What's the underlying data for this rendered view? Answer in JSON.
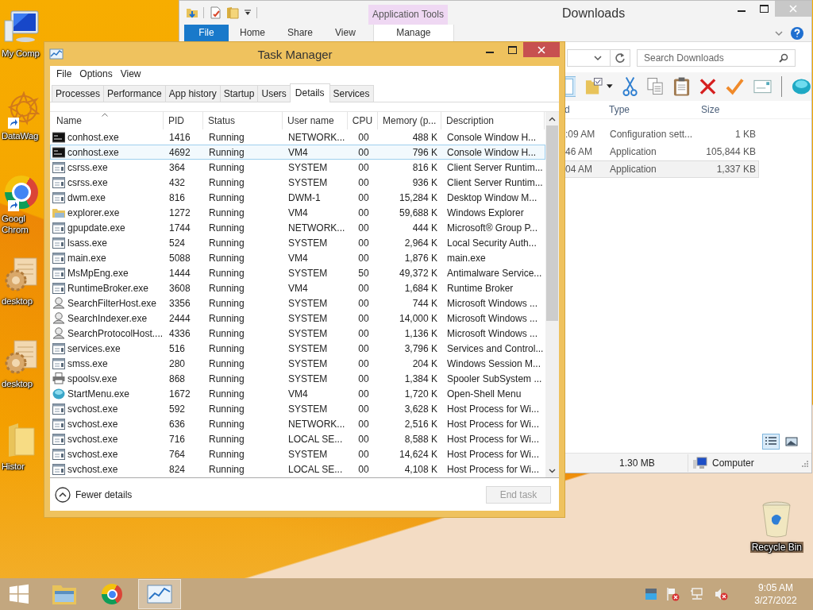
{
  "desktop_icons": [
    {
      "kind": "computer",
      "lines": [
        "My Comp"
      ],
      "shortcut": false
    },
    {
      "kind": "flower",
      "lines": [
        "DataWag"
      ],
      "shortcut": true
    },
    {
      "kind": "chrome",
      "lines": [
        "Googl",
        "Chrom"
      ],
      "shortcut": true
    },
    {
      "kind": "gear-doc",
      "lines": [
        "desktop"
      ],
      "shortcut": false
    },
    {
      "kind": "gear-doc",
      "lines": [
        "desktop"
      ],
      "shortcut": false
    },
    {
      "kind": "folder",
      "lines": [
        "Histor"
      ],
      "shortcut": false
    }
  ],
  "recycle_bin": {
    "label": "Recycle Bin"
  },
  "explorer": {
    "title": "Downloads",
    "context_tab": "Application Tools",
    "ribbon_tabs": [
      {
        "label": "File",
        "selected": true
      },
      {
        "label": "Home",
        "selected": false
      },
      {
        "label": "Share",
        "selected": false
      },
      {
        "label": "View",
        "selected": false
      },
      {
        "label": "Manage",
        "selected": false
      }
    ],
    "search": {
      "placeholder": "Search Downloads"
    },
    "columns": [
      "d",
      "Type",
      "Size"
    ],
    "rows": [
      {
        "date": ":09 AM",
        "type": "Configuration sett...",
        "size": "1 KB",
        "selected": false
      },
      {
        "date": "46 AM",
        "type": "Application",
        "size": "105,844 KB",
        "selected": false
      },
      {
        "date": "04 AM",
        "type": "Application",
        "size": "1,337 KB",
        "selected": true
      }
    ],
    "status_bar": {
      "size": "1.30 MB",
      "location": "Computer"
    }
  },
  "task_manager": {
    "title": "Task Manager",
    "menu": [
      "File",
      "Options",
      "View"
    ],
    "tabs": [
      {
        "label": "Processes",
        "selected": false
      },
      {
        "label": "Performance",
        "selected": false
      },
      {
        "label": "App history",
        "selected": false
      },
      {
        "label": "Startup",
        "selected": false
      },
      {
        "label": "Users",
        "selected": false
      },
      {
        "label": "Details",
        "selected": true
      },
      {
        "label": "Services",
        "selected": false
      }
    ],
    "columns": [
      {
        "label": "Name",
        "sorted": true
      },
      {
        "label": "PID",
        "sorted": false
      },
      {
        "label": "Status",
        "sorted": false
      },
      {
        "label": "User name",
        "sorted": false
      },
      {
        "label": "CPU",
        "sorted": false
      },
      {
        "label": "Memory (p...",
        "sorted": false
      },
      {
        "label": "Description",
        "sorted": false
      }
    ],
    "rows": [
      {
        "kind": "console",
        "name": "conhost.exe",
        "pid": "1416",
        "status": "Running",
        "user": "NETWORK...",
        "cpu": "00",
        "memory": "488 K",
        "description": "Console Window H...",
        "selected": false
      },
      {
        "kind": "console",
        "name": "conhost.exe",
        "pid": "4692",
        "status": "Running",
        "user": "VM4",
        "cpu": "00",
        "memory": "796 K",
        "description": "Console Window H...",
        "selected": true
      },
      {
        "kind": "app",
        "name": "csrss.exe",
        "pid": "364",
        "status": "Running",
        "user": "SYSTEM",
        "cpu": "00",
        "memory": "816 K",
        "description": "Client Server Runtim...",
        "selected": false
      },
      {
        "kind": "app",
        "name": "csrss.exe",
        "pid": "432",
        "status": "Running",
        "user": "SYSTEM",
        "cpu": "00",
        "memory": "936 K",
        "description": "Client Server Runtim...",
        "selected": false
      },
      {
        "kind": "app",
        "name": "dwm.exe",
        "pid": "816",
        "status": "Running",
        "user": "DWM-1",
        "cpu": "00",
        "memory": "15,284 K",
        "description": "Desktop Window M...",
        "selected": false
      },
      {
        "kind": "folder",
        "name": "explorer.exe",
        "pid": "1272",
        "status": "Running",
        "user": "VM4",
        "cpu": "00",
        "memory": "59,688 K",
        "description": "Windows Explorer",
        "selected": false
      },
      {
        "kind": "app",
        "name": "gpupdate.exe",
        "pid": "1744",
        "status": "Running",
        "user": "NETWORK...",
        "cpu": "00",
        "memory": "444 K",
        "description": "Microsoft® Group P...",
        "selected": false
      },
      {
        "kind": "app",
        "name": "lsass.exe",
        "pid": "524",
        "status": "Running",
        "user": "SYSTEM",
        "cpu": "00",
        "memory": "2,964 K",
        "description": "Local Security Auth...",
        "selected": false
      },
      {
        "kind": "app",
        "name": "main.exe",
        "pid": "5088",
        "status": "Running",
        "user": "VM4",
        "cpu": "00",
        "memory": "1,876 K",
        "description": "main.exe",
        "selected": false
      },
      {
        "kind": "app",
        "name": "MsMpEng.exe",
        "pid": "1444",
        "status": "Running",
        "user": "SYSTEM",
        "cpu": "50",
        "memory": "49,372 K",
        "description": "Antimalware Service...",
        "selected": false
      },
      {
        "kind": "app",
        "name": "RuntimeBroker.exe",
        "pid": "3608",
        "status": "Running",
        "user": "VM4",
        "cpu": "00",
        "memory": "1,684 K",
        "description": "Runtime Broker",
        "selected": false
      },
      {
        "kind": "search",
        "name": "SearchFilterHost.exe",
        "pid": "3356",
        "status": "Running",
        "user": "SYSTEM",
        "cpu": "00",
        "memory": "744 K",
        "description": "Microsoft Windows ...",
        "selected": false
      },
      {
        "kind": "search",
        "name": "SearchIndexer.exe",
        "pid": "2444",
        "status": "Running",
        "user": "SYSTEM",
        "cpu": "00",
        "memory": "14,000 K",
        "description": "Microsoft Windows ...",
        "selected": false
      },
      {
        "kind": "search",
        "name": "SearchProtocolHost....",
        "pid": "4336",
        "status": "Running",
        "user": "SYSTEM",
        "cpu": "00",
        "memory": "1,136 K",
        "description": "Microsoft Windows ...",
        "selected": false
      },
      {
        "kind": "app",
        "name": "services.exe",
        "pid": "516",
        "status": "Running",
        "user": "SYSTEM",
        "cpu": "00",
        "memory": "3,796 K",
        "description": "Services and Control...",
        "selected": false
      },
      {
        "kind": "app",
        "name": "smss.exe",
        "pid": "280",
        "status": "Running",
        "user": "SYSTEM",
        "cpu": "00",
        "memory": "204 K",
        "description": "Windows Session M...",
        "selected": false
      },
      {
        "kind": "printer",
        "name": "spoolsv.exe",
        "pid": "868",
        "status": "Running",
        "user": "SYSTEM",
        "cpu": "00",
        "memory": "1,384 K",
        "description": "Spooler SubSystem ...",
        "selected": false
      },
      {
        "kind": "globe",
        "name": "StartMenu.exe",
        "pid": "1672",
        "status": "Running",
        "user": "VM4",
        "cpu": "00",
        "memory": "1,720 K",
        "description": "Open-Shell Menu",
        "selected": false
      },
      {
        "kind": "app",
        "name": "svchost.exe",
        "pid": "592",
        "status": "Running",
        "user": "SYSTEM",
        "cpu": "00",
        "memory": "3,628 K",
        "description": "Host Process for Wi...",
        "selected": false
      },
      {
        "kind": "app",
        "name": "svchost.exe",
        "pid": "636",
        "status": "Running",
        "user": "NETWORK...",
        "cpu": "00",
        "memory": "2,516 K",
        "description": "Host Process for Wi...",
        "selected": false
      },
      {
        "kind": "app",
        "name": "svchost.exe",
        "pid": "716",
        "status": "Running",
        "user": "LOCAL SE...",
        "cpu": "00",
        "memory": "8,588 K",
        "description": "Host Process for Wi...",
        "selected": false
      },
      {
        "kind": "app",
        "name": "svchost.exe",
        "pid": "764",
        "status": "Running",
        "user": "SYSTEM",
        "cpu": "00",
        "memory": "14,624 K",
        "description": "Host Process for Wi...",
        "selected": false
      },
      {
        "kind": "app",
        "name": "svchost.exe",
        "pid": "824",
        "status": "Running",
        "user": "LOCAL SE...",
        "cpu": "00",
        "memory": "4,108 K",
        "description": "Host Process for Wi...",
        "selected": false
      }
    ],
    "fewer_details": "Fewer details",
    "end_task": {
      "label": "End task",
      "disabled": true
    }
  },
  "taskbar": {
    "buttons": [
      {
        "kind": "explorer",
        "selected": false
      },
      {
        "kind": "chrome",
        "selected": false
      },
      {
        "kind": "task-manager",
        "selected": true
      }
    ],
    "clock": {
      "time": "9:05 AM",
      "date": "3/27/2022"
    }
  }
}
